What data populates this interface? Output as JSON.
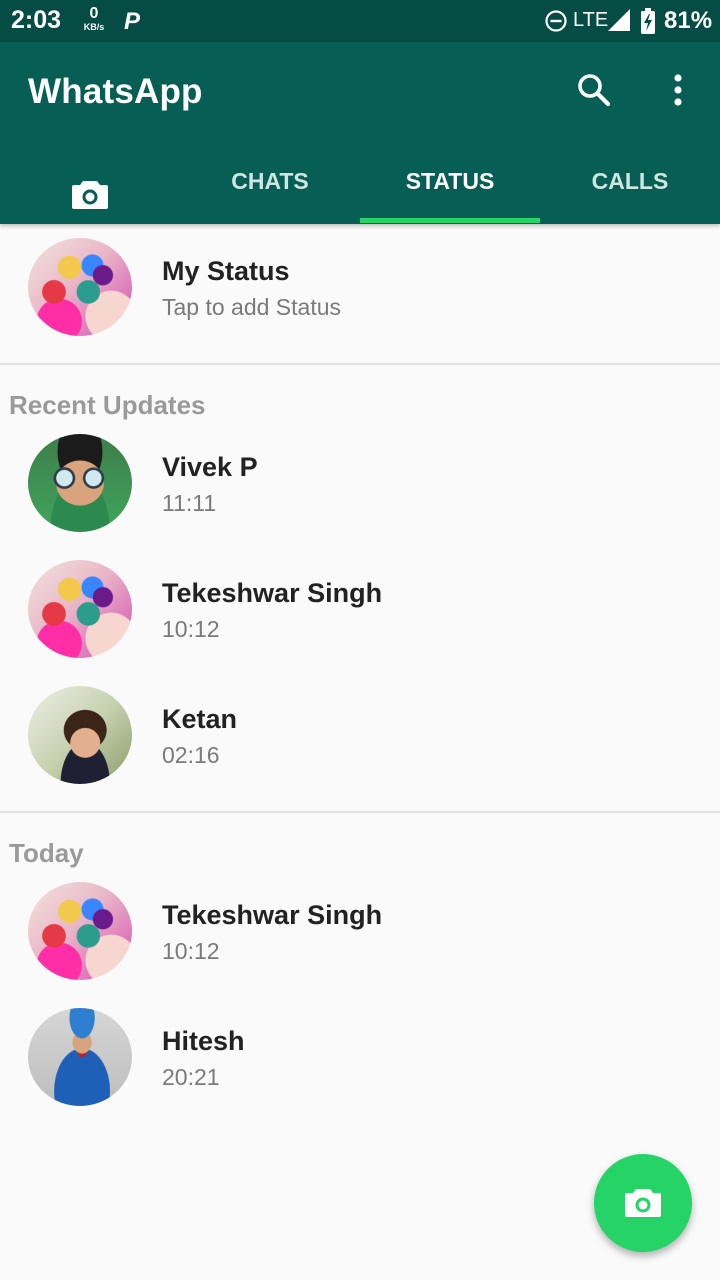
{
  "status_bar": {
    "time": "2:03",
    "net_speed_value": "0",
    "net_speed_unit": "KB/s",
    "app_indicator": "P",
    "network": "LTE",
    "battery": "81%",
    "icons": [
      "dnd-icon",
      "signal-icon",
      "battery-charging-icon"
    ]
  },
  "header": {
    "title": "WhatsApp",
    "actions": [
      "search-icon",
      "more-vert-icon"
    ]
  },
  "tabs": [
    {
      "label": "",
      "icon": "camera-icon"
    },
    {
      "label": "CHATS"
    },
    {
      "label": "STATUS",
      "active": true
    },
    {
      "label": "CALLS"
    }
  ],
  "my_status": {
    "name": "My Status",
    "subtitle": "Tap to add Status"
  },
  "recent": {
    "title": "Recent Updates",
    "items": [
      {
        "name": "Vivek P",
        "time": "11:11"
      },
      {
        "name": "Tekeshwar Singh",
        "time": "10:12"
      },
      {
        "name": "Ketan",
        "time": "02:16"
      }
    ]
  },
  "today": {
    "title": "Today",
    "items": [
      {
        "name": "Tekeshwar Singh",
        "time": "10:12"
      },
      {
        "name": "Hitesh",
        "time": "20:21"
      }
    ]
  },
  "fab": {
    "icon": "camera-icon"
  },
  "colors": {
    "status_bar": "#054d44",
    "app_bar": "#075e54",
    "accent": "#25d366"
  }
}
